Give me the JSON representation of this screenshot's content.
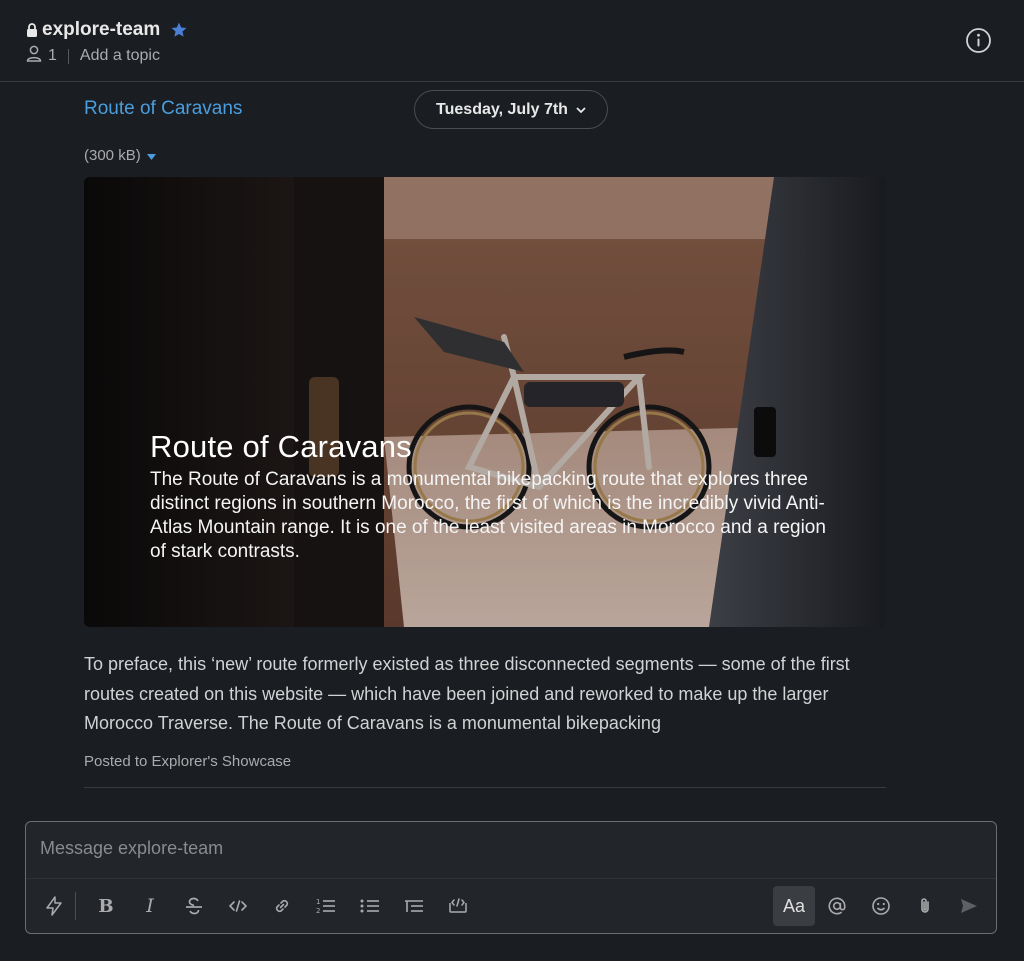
{
  "header": {
    "channel_name": "explore-team",
    "member_count": "1",
    "topic_placeholder": "Add a topic",
    "icons": [
      "lock-icon",
      "star-icon",
      "person-icon",
      "info-icon"
    ]
  },
  "message": {
    "link_title": "Route of Caravans",
    "date_label": "Tuesday, July 7th",
    "file_size": "(300 kB)",
    "image_overlay": {
      "title": "Route of Caravans",
      "description": "The Route of Caravans is a monumental bikepacking route that explores three distinct regions in southern Morocco, the first of which is the incredibly vivid Anti-Atlas Mountain range. It is one of the least visited areas in Morocco and a region of stark contrasts."
    },
    "body": "To preface, this ‘new’ route formerly existed as three disconnected segments — some of the first routes created on this website — which have been joined and reworked to make up the larger Morocco Traverse. The Route of Caravans is a monumental bikepacking",
    "posted_to": "Posted to Explorer's Showcase"
  },
  "composer": {
    "placeholder": "Message explore-team",
    "format_label": "Aa"
  },
  "colors": {
    "background": "#1a1d21",
    "link": "#4a9ede",
    "star": "#4a7fd6"
  }
}
